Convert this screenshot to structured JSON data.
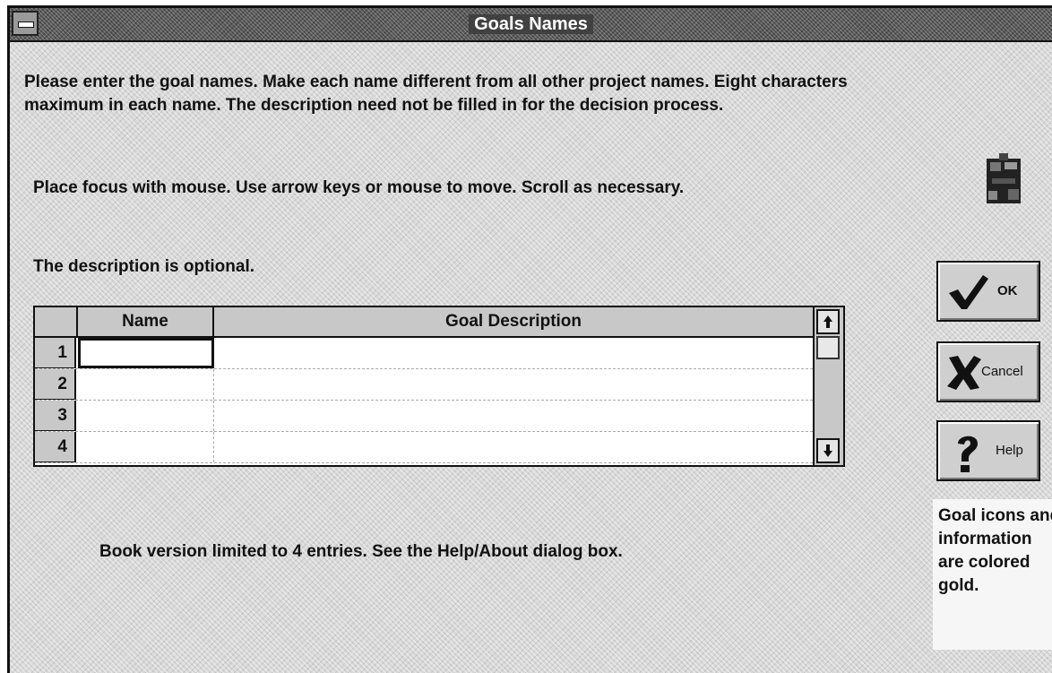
{
  "window": {
    "title": "Goals Names"
  },
  "instructions": {
    "paragraph1": "Please enter the goal names. Make each name different from all other project names. Eight characters maximum in each name. The description need not be filled in for the decision process.",
    "paragraph2": "Place focus with mouse. Use arrow keys or mouse to move. Scroll as necessary.",
    "paragraph3": "The description is optional."
  },
  "grid": {
    "columns": [
      "",
      "Name",
      "Goal Description"
    ],
    "rows": [
      {
        "number": "1",
        "name": "",
        "description": ""
      },
      {
        "number": "2",
        "name": "",
        "description": ""
      },
      {
        "number": "3",
        "name": "",
        "description": ""
      },
      {
        "number": "4",
        "name": "",
        "description": ""
      }
    ],
    "focused_row": 1
  },
  "footnote": "Book version limited to 4 entries. See the Help/About dialog box.",
  "buttons": {
    "ok": "OK",
    "cancel": "Cancel",
    "help": "Help"
  },
  "info": "Goal icons and information are colored gold.",
  "icons": {
    "system_menu": "system-menu-icon",
    "logo": "app-logo-icon",
    "ok": "checkmark-icon",
    "cancel": "x-icon",
    "help": "question-mark-icon",
    "scroll_up": "arrow-up-icon",
    "scroll_down": "arrow-down-icon"
  }
}
